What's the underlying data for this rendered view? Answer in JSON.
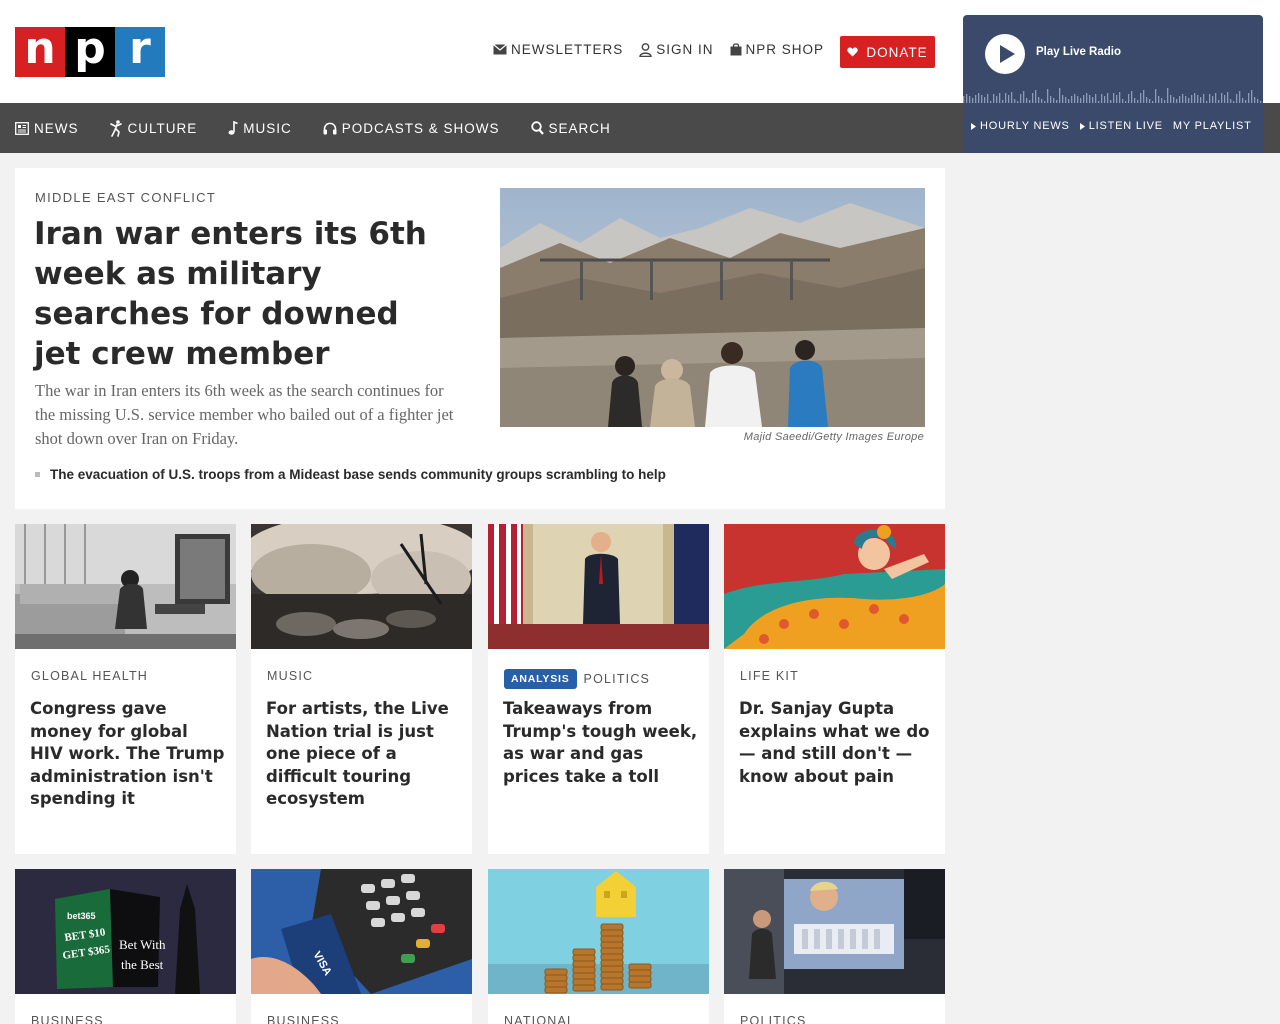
{
  "brand": {
    "logo_letters": [
      "n",
      "p",
      "r"
    ],
    "colors": {
      "red": "#d62021",
      "black": "#000000",
      "blue": "#237bbd"
    }
  },
  "utility": {
    "newsletters": "NEWSLETTERS",
    "sign_in": "SIGN IN",
    "shop": "NPR SHOP",
    "donate": "DONATE"
  },
  "nav": {
    "items": [
      {
        "label": "NEWS",
        "icon": "news-icon"
      },
      {
        "label": "CULTURE",
        "icon": "culture-icon"
      },
      {
        "label": "MUSIC",
        "icon": "music-note-icon"
      },
      {
        "label": "PODCASTS & SHOWS",
        "icon": "headphones-icon"
      },
      {
        "label": "SEARCH",
        "icon": "search-icon"
      }
    ]
  },
  "player": {
    "label": "Play Live Radio",
    "links": [
      "HOURLY NEWS",
      "LISTEN LIVE",
      "MY PLAYLIST"
    ]
  },
  "lead": {
    "slug": "MIDDLE EAST CONFLICT",
    "title": "Iran war enters its 6th week as military searches for downed jet crew member",
    "teaser": "The war in Iran enters its 6th week as the search continues for the missing U.S. service member who bailed out of a fighter jet shot down over Iran on Friday.",
    "caption": "Majid Saeedi/Getty Images Europe",
    "related": "The evacuation of U.S. troops from a Mideast base sends community groups scrambling to help"
  },
  "cards_row1": [
    {
      "slug": "GLOBAL HEALTH",
      "badge": "",
      "title": "Congress gave money for global HIV work. The Trump administration isn't spending it"
    },
    {
      "slug": "MUSIC",
      "badge": "",
      "title": "For artists, the Live Nation trial is just one piece of a difficult touring ecosystem"
    },
    {
      "slug": "POLITICS",
      "badge": "ANALYSIS",
      "title": "Takeaways from Trump's tough week, as war and gas prices take a toll"
    },
    {
      "slug": "LIFE KIT",
      "badge": "",
      "title": "Dr. Sanjay Gupta explains what we do — and still don't — know about pain"
    }
  ],
  "cards_row2": [
    {
      "slug": "BUSINESS"
    },
    {
      "slug": "BUSINESS"
    },
    {
      "slug": "NATIONAL"
    },
    {
      "slug": "POLITICS"
    }
  ],
  "image_text": {
    "billboard": [
      "bet365",
      "BET $10",
      "GET $365",
      "Bet With",
      "the Best"
    ],
    "card_brand": "VISA"
  }
}
